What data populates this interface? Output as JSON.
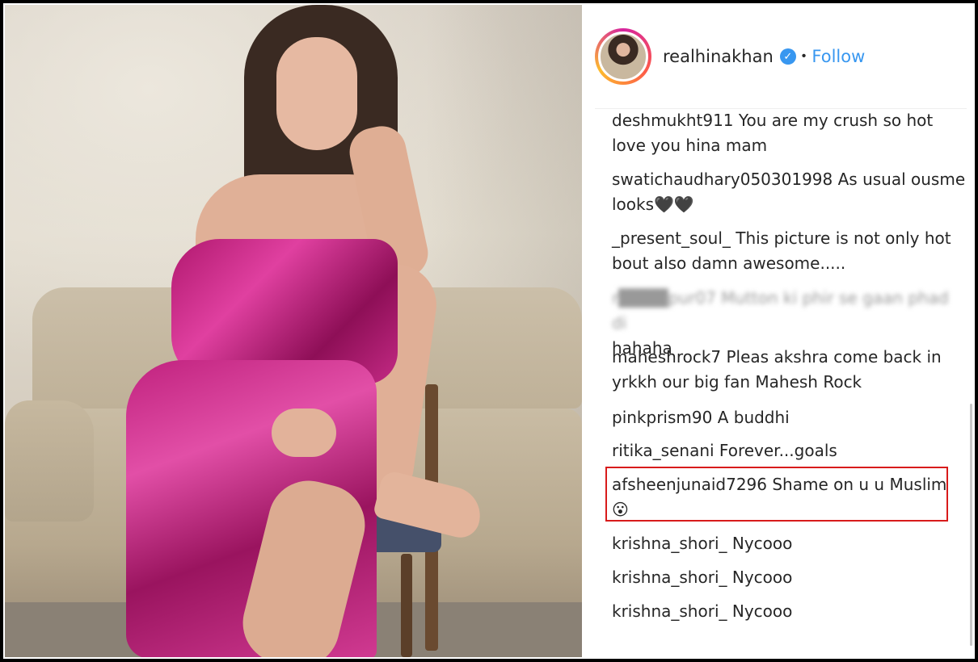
{
  "header": {
    "username": "realhinakhan",
    "verified_icon": "✓",
    "separator": "•",
    "follow_label": "Follow"
  },
  "colors": {
    "accent": "#3897f0",
    "highlight_border": "#d81b1b",
    "text": "#262626"
  },
  "comments": [
    {
      "user": "deshmukht911",
      "text": "You are my crush so hot",
      "cont": "love you hina mam"
    },
    {
      "user": "swatichaudhary050301998",
      "text": "As usual ousme",
      "cont": "looks🖤🖤"
    },
    {
      "user": "_present_soul_",
      "text": "This picture is not only hot",
      "cont": "bout also damn awesome....."
    },
    {
      "user": "",
      "text": "",
      "cont": "hahaha",
      "blurred": true
    },
    {
      "user": "maheshrock7",
      "text": "Pleas akshra come back in",
      "cont": "yrkkh our big fan Mahesh Rock"
    },
    {
      "user": "pinkprism90",
      "text": "A buddhi",
      "cont": ""
    },
    {
      "user": "ritika_senani",
      "text": "Forever...goals",
      "cont": ""
    },
    {
      "user": "afsheenjunaid7296",
      "text": "Shame on u u Muslim",
      "cont": "😮",
      "highlighted": true
    },
    {
      "user": "krishna_shori_",
      "text": "Nycooo",
      "cont": ""
    },
    {
      "user": "krishna_shori_",
      "text": "Nycooo",
      "cont": ""
    },
    {
      "user": "krishna_shori_",
      "text": "Nycooo",
      "cont": ""
    }
  ]
}
